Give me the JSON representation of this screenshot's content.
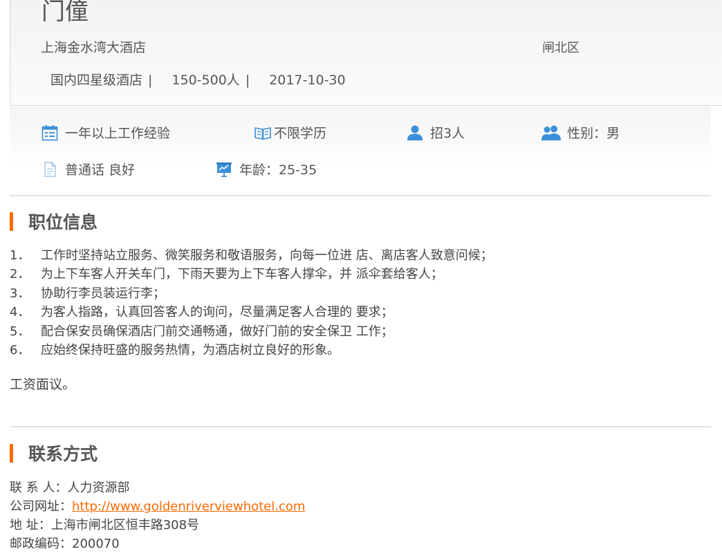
{
  "job": {
    "title": "门僮",
    "company": "上海金水湾大酒店",
    "district": "闸北区",
    "hotel_type": "国内四星级酒店",
    "size": "150-500人",
    "date": "2017-10-30",
    "separator": "|"
  },
  "requirements": {
    "experience": "一年以上工作经验",
    "education": "不限学历",
    "headcount": "招3人",
    "gender": "性别：男",
    "language": "普通话 良好",
    "age": "年龄：25-35"
  },
  "sections": {
    "position_info": "职位信息",
    "contact": "联系方式"
  },
  "duties": [
    {
      "num": "1．",
      "text": "工作时坚持站立服务、微笑服务和敬语服务，向每一位进 店、离店客人致意问候；"
    },
    {
      "num": "2．",
      "text": "为上下车客人开关车门，下雨天要为上下车客人撑伞，并 派伞套给客人；"
    },
    {
      "num": "3．",
      "text": "协助行李员装运行李；"
    },
    {
      "num": "4．",
      "text": "为客人指路，认真回答客人的询问，尽量满足客人合理的 要求；"
    },
    {
      "num": "5．",
      "text": "配合保安员确保酒店门前交通畅通，做好门前的安全保卫 工作；"
    },
    {
      "num": "6．",
      "text": "应始终保持旺盛的服务热情，为酒店树立良好的形象。"
    }
  ],
  "salary": "工资面议。",
  "contact": {
    "person_label": "联 系 人：",
    "person": "人力资源部",
    "website_label": "公司网址：",
    "website": "http://www.goldenriverviewhotel.com",
    "address_label": "地 址：",
    "address": "上海市闸北区恒丰路308号",
    "zip_label": "邮政编码：",
    "zip": "200070"
  },
  "colors": {
    "accent": "#ff6a00",
    "icon_blue": "#3b8fd8",
    "text": "#555555"
  },
  "icons": {
    "experience": "calendar-icon",
    "education": "book-icon",
    "headcount": "person-icon",
    "gender": "people-icon",
    "language": "document-icon",
    "age": "presentation-icon"
  }
}
